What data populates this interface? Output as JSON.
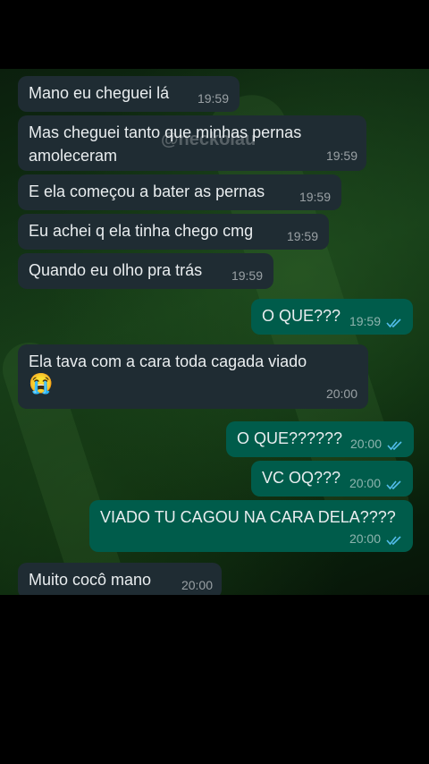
{
  "watermark": "@neckolau",
  "messages": [
    {
      "text": "Mano eu cheguei lá",
      "time": "19:59"
    },
    {
      "line1": "Mas cheguei tanto que minhas pernas",
      "line2": "amoleceram",
      "time": "19:59"
    },
    {
      "text": "E ela começou a bater as pernas",
      "time": "19:59"
    },
    {
      "text": "Eu achei q ela tinha chego cmg",
      "time": "19:59"
    },
    {
      "text": "Quando eu olho pra trás",
      "time": "19:59"
    },
    {
      "text": "O QUE???",
      "time": "19:59"
    },
    {
      "text": "Ela tava com a cara toda cagada viado",
      "emoji": "😭",
      "time": "20:00"
    },
    {
      "text": "O QUE??????",
      "time": "20:00"
    },
    {
      "text": "VC OQ???",
      "time": "20:00"
    },
    {
      "text": "VIADO TU CAGOU NA CARA DELA????",
      "time": "20:00"
    },
    {
      "text": "Muito cocô mano",
      "time": "20:00"
    }
  ],
  "colors": {
    "incoming": "#1f2c33",
    "outgoing": "#005c4b",
    "read_ticks": "#53bdeb"
  },
  "icons": {
    "read": "double-check-icon"
  }
}
